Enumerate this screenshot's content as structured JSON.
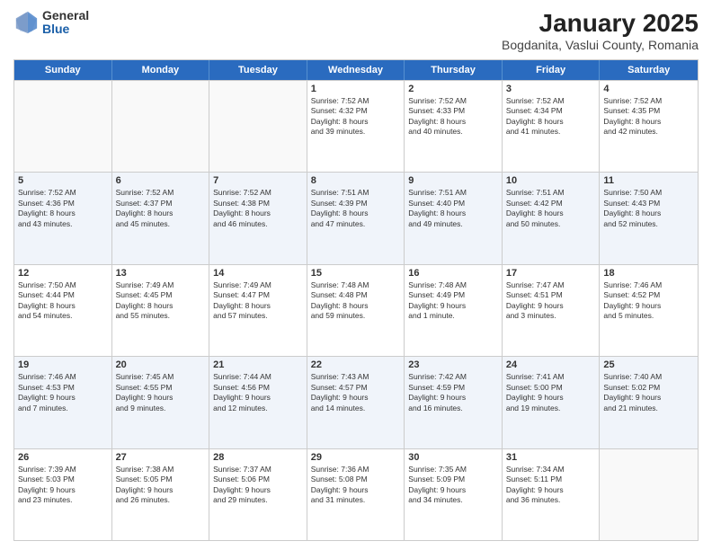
{
  "logo": {
    "general": "General",
    "blue": "Blue"
  },
  "title": "January 2025",
  "subtitle": "Bogdanita, Vaslui County, Romania",
  "days": [
    "Sunday",
    "Monday",
    "Tuesday",
    "Wednesday",
    "Thursday",
    "Friday",
    "Saturday"
  ],
  "weeks": [
    [
      {
        "day": "",
        "text": ""
      },
      {
        "day": "",
        "text": ""
      },
      {
        "day": "",
        "text": ""
      },
      {
        "day": "1",
        "text": "Sunrise: 7:52 AM\nSunset: 4:32 PM\nDaylight: 8 hours\nand 39 minutes."
      },
      {
        "day": "2",
        "text": "Sunrise: 7:52 AM\nSunset: 4:33 PM\nDaylight: 8 hours\nand 40 minutes."
      },
      {
        "day": "3",
        "text": "Sunrise: 7:52 AM\nSunset: 4:34 PM\nDaylight: 8 hours\nand 41 minutes."
      },
      {
        "day": "4",
        "text": "Sunrise: 7:52 AM\nSunset: 4:35 PM\nDaylight: 8 hours\nand 42 minutes."
      }
    ],
    [
      {
        "day": "5",
        "text": "Sunrise: 7:52 AM\nSunset: 4:36 PM\nDaylight: 8 hours\nand 43 minutes."
      },
      {
        "day": "6",
        "text": "Sunrise: 7:52 AM\nSunset: 4:37 PM\nDaylight: 8 hours\nand 45 minutes."
      },
      {
        "day": "7",
        "text": "Sunrise: 7:52 AM\nSunset: 4:38 PM\nDaylight: 8 hours\nand 46 minutes."
      },
      {
        "day": "8",
        "text": "Sunrise: 7:51 AM\nSunset: 4:39 PM\nDaylight: 8 hours\nand 47 minutes."
      },
      {
        "day": "9",
        "text": "Sunrise: 7:51 AM\nSunset: 4:40 PM\nDaylight: 8 hours\nand 49 minutes."
      },
      {
        "day": "10",
        "text": "Sunrise: 7:51 AM\nSunset: 4:42 PM\nDaylight: 8 hours\nand 50 minutes."
      },
      {
        "day": "11",
        "text": "Sunrise: 7:50 AM\nSunset: 4:43 PM\nDaylight: 8 hours\nand 52 minutes."
      }
    ],
    [
      {
        "day": "12",
        "text": "Sunrise: 7:50 AM\nSunset: 4:44 PM\nDaylight: 8 hours\nand 54 minutes."
      },
      {
        "day": "13",
        "text": "Sunrise: 7:49 AM\nSunset: 4:45 PM\nDaylight: 8 hours\nand 55 minutes."
      },
      {
        "day": "14",
        "text": "Sunrise: 7:49 AM\nSunset: 4:47 PM\nDaylight: 8 hours\nand 57 minutes."
      },
      {
        "day": "15",
        "text": "Sunrise: 7:48 AM\nSunset: 4:48 PM\nDaylight: 8 hours\nand 59 minutes."
      },
      {
        "day": "16",
        "text": "Sunrise: 7:48 AM\nSunset: 4:49 PM\nDaylight: 9 hours\nand 1 minute."
      },
      {
        "day": "17",
        "text": "Sunrise: 7:47 AM\nSunset: 4:51 PM\nDaylight: 9 hours\nand 3 minutes."
      },
      {
        "day": "18",
        "text": "Sunrise: 7:46 AM\nSunset: 4:52 PM\nDaylight: 9 hours\nand 5 minutes."
      }
    ],
    [
      {
        "day": "19",
        "text": "Sunrise: 7:46 AM\nSunset: 4:53 PM\nDaylight: 9 hours\nand 7 minutes."
      },
      {
        "day": "20",
        "text": "Sunrise: 7:45 AM\nSunset: 4:55 PM\nDaylight: 9 hours\nand 9 minutes."
      },
      {
        "day": "21",
        "text": "Sunrise: 7:44 AM\nSunset: 4:56 PM\nDaylight: 9 hours\nand 12 minutes."
      },
      {
        "day": "22",
        "text": "Sunrise: 7:43 AM\nSunset: 4:57 PM\nDaylight: 9 hours\nand 14 minutes."
      },
      {
        "day": "23",
        "text": "Sunrise: 7:42 AM\nSunset: 4:59 PM\nDaylight: 9 hours\nand 16 minutes."
      },
      {
        "day": "24",
        "text": "Sunrise: 7:41 AM\nSunset: 5:00 PM\nDaylight: 9 hours\nand 19 minutes."
      },
      {
        "day": "25",
        "text": "Sunrise: 7:40 AM\nSunset: 5:02 PM\nDaylight: 9 hours\nand 21 minutes."
      }
    ],
    [
      {
        "day": "26",
        "text": "Sunrise: 7:39 AM\nSunset: 5:03 PM\nDaylight: 9 hours\nand 23 minutes."
      },
      {
        "day": "27",
        "text": "Sunrise: 7:38 AM\nSunset: 5:05 PM\nDaylight: 9 hours\nand 26 minutes."
      },
      {
        "day": "28",
        "text": "Sunrise: 7:37 AM\nSunset: 5:06 PM\nDaylight: 9 hours\nand 29 minutes."
      },
      {
        "day": "29",
        "text": "Sunrise: 7:36 AM\nSunset: 5:08 PM\nDaylight: 9 hours\nand 31 minutes."
      },
      {
        "day": "30",
        "text": "Sunrise: 7:35 AM\nSunset: 5:09 PM\nDaylight: 9 hours\nand 34 minutes."
      },
      {
        "day": "31",
        "text": "Sunrise: 7:34 AM\nSunset: 5:11 PM\nDaylight: 9 hours\nand 36 minutes."
      },
      {
        "day": "",
        "text": ""
      }
    ]
  ]
}
